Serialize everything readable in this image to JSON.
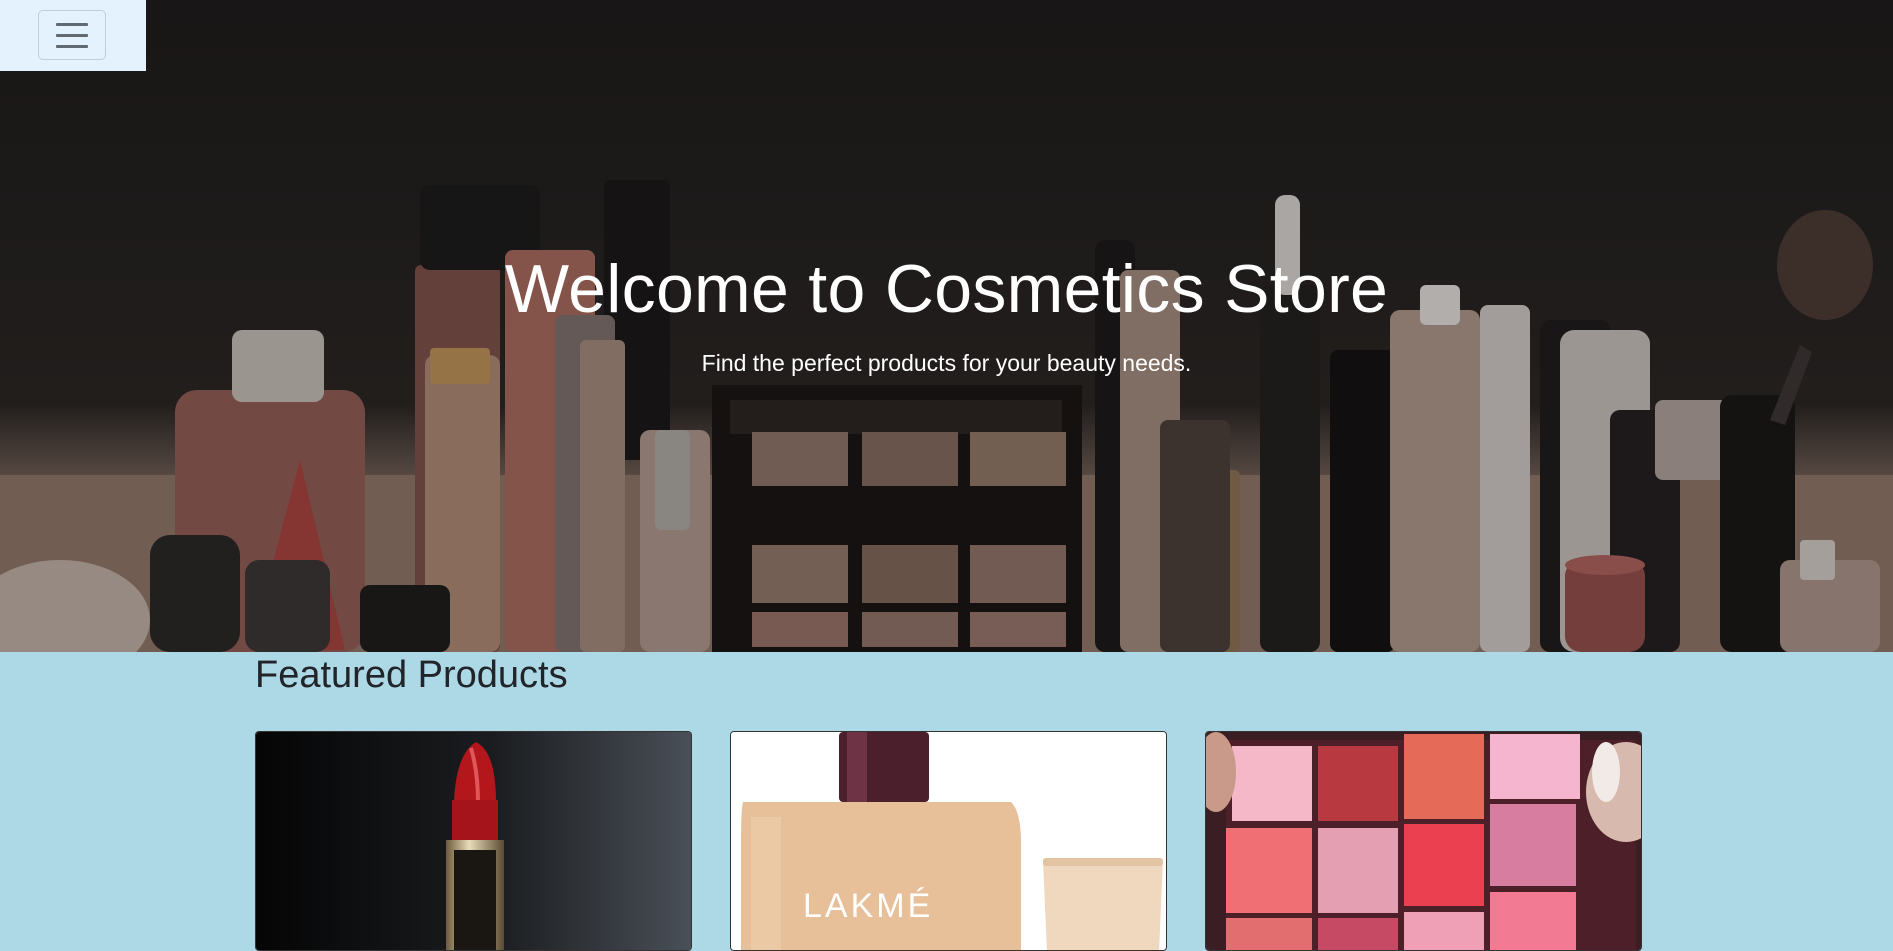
{
  "navbar": {
    "toggler_icon": "hamburger-menu-icon"
  },
  "hero": {
    "title": "Welcome to Cosmetics Store",
    "subtitle": "Find the perfect products for your beauty needs."
  },
  "featured": {
    "title": "Featured Products",
    "products": [
      {
        "image": "red-lipstick-image"
      },
      {
        "image": "lakme-foundation-image",
        "brand_text": "LAKMÉ"
      },
      {
        "image": "eyeshadow-palette-image"
      }
    ]
  },
  "colors": {
    "page_background": "#add8e6",
    "navbar_background": "#e3f2fd",
    "hero_text": "#ffffff",
    "heading_text": "#212529"
  }
}
